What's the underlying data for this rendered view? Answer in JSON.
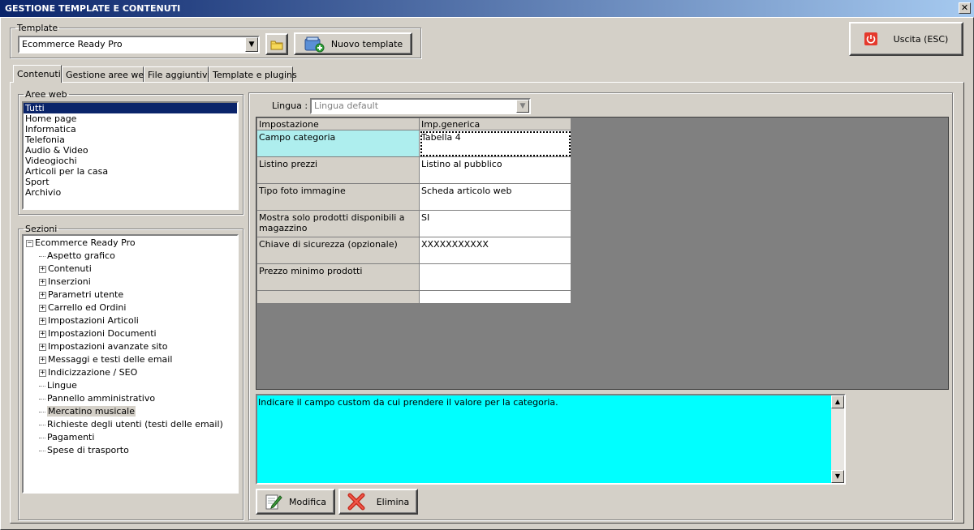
{
  "window": {
    "title": "GESTIONE TEMPLATE E CONTENUTI"
  },
  "template": {
    "group_label": "Template",
    "selected": "Ecommerce Ready Pro",
    "new_button": "Nuovo template"
  },
  "exit_button": "Uscita (ESC)",
  "tabs": [
    {
      "label": "Contenuti",
      "active": true
    },
    {
      "label": "Gestione aree web",
      "active": false
    },
    {
      "label": "File aggiuntivi",
      "active": false
    },
    {
      "label": "Template e plugins",
      "active": false
    }
  ],
  "aree_web": {
    "label": "Aree web",
    "items": [
      "Tutti",
      "Home page",
      "Informatica",
      "Telefonia",
      "Audio & Video",
      "Videogiochi",
      "Articoli per la casa",
      "Sport",
      "Archivio"
    ],
    "selected": "Tutti"
  },
  "sezioni": {
    "label": "Sezioni",
    "root": "Ecommerce Ready Pro",
    "items": [
      {
        "label": "Aspetto grafico",
        "expandable": false
      },
      {
        "label": "Contenuti",
        "expandable": true
      },
      {
        "label": "Inserzioni",
        "expandable": true
      },
      {
        "label": "Parametri utente",
        "expandable": true
      },
      {
        "label": "Carrello ed Ordini",
        "expandable": true
      },
      {
        "label": "Impostazioni Articoli",
        "expandable": true
      },
      {
        "label": "Impostazioni Documenti",
        "expandable": true
      },
      {
        "label": "Impostazioni avanzate sito",
        "expandable": true
      },
      {
        "label": "Messaggi e testi delle email",
        "expandable": true
      },
      {
        "label": "Indicizzazione / SEO",
        "expandable": true
      },
      {
        "label": "Lingue",
        "expandable": false
      },
      {
        "label": "Pannello amministrativo",
        "expandable": false
      },
      {
        "label": "Mercatino musicale",
        "expandable": false,
        "selected": true
      },
      {
        "label": "Richieste degli utenti (testi delle email)",
        "expandable": false
      },
      {
        "label": "Pagamenti",
        "expandable": false
      },
      {
        "label": "Spese di trasporto",
        "expandable": false
      }
    ]
  },
  "lingua": {
    "label": "Lingua :",
    "value": "Lingua default"
  },
  "grid": {
    "headers": [
      "Impostazione",
      "Imp.generica"
    ],
    "rows": [
      {
        "key": "Campo categoria",
        "value": "Tabella 4"
      },
      {
        "key": "Listino prezzi",
        "value": "Listino al pubblico"
      },
      {
        "key": "Tipo foto immagine",
        "value": "Scheda articolo web"
      },
      {
        "key": "Mostra solo prodotti disponibili a magazzino",
        "value": "SI"
      },
      {
        "key": "Chiave di sicurezza (opzionale)",
        "value": "XXXXXXXXXXX"
      },
      {
        "key": "Prezzo minimo prodotti",
        "value": ""
      }
    ]
  },
  "description": "Indicare il campo custom da cui prendere il valore per la categoria.",
  "actions": {
    "modify": "Modifica",
    "delete": "Elimina"
  },
  "colors": {
    "titlebar": "#0a246a",
    "description_bg": "#00ffff",
    "selected_key_bg": "#aeeeee",
    "grid_empty": "#808080"
  }
}
